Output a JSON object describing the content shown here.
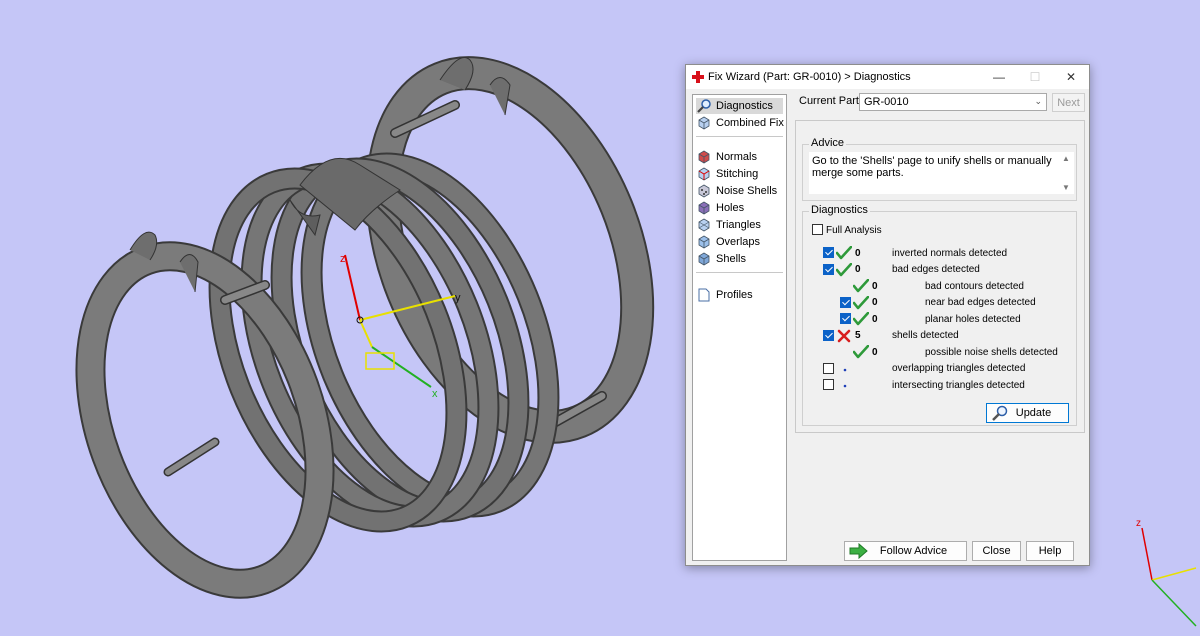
{
  "dialog": {
    "title": "Fix Wizard (Part: GR-0010) > Diagnostics",
    "window_controls": {
      "minimize": "—",
      "maximize": "☐",
      "close": "✕"
    },
    "nav": [
      {
        "label": "Diagnostics",
        "icon": "magnifier-icon",
        "active": true
      },
      {
        "label": "Combined Fix",
        "icon": "cube-icon"
      },
      {
        "label": "Normals",
        "icon": "normals-cube-icon"
      },
      {
        "label": "Stitching",
        "icon": "stitching-cube-icon"
      },
      {
        "label": "Noise Shells",
        "icon": "noise-shells-icon"
      },
      {
        "label": "Holes",
        "icon": "holes-cube-icon"
      },
      {
        "label": "Triangles",
        "icon": "triangles-cube-icon"
      },
      {
        "label": "Overlaps",
        "icon": "overlaps-cube-icon"
      },
      {
        "label": "Shells",
        "icon": "shells-cube-icon"
      },
      {
        "label": "Profiles",
        "icon": "document-icon"
      }
    ],
    "current_part": {
      "label": "Current Part:",
      "value": "GR-0010"
    },
    "next_label": "Next",
    "advice": {
      "label": "Advice",
      "text": "Go to the 'Shells' page to unify shells or manually merge some parts."
    },
    "diagnostics": {
      "label": "Diagnostics",
      "full_analysis": {
        "label": "Full Analysis",
        "checked": false
      },
      "rows": [
        {
          "checked": true,
          "status": "ok",
          "count": "0",
          "label": "inverted normals detected",
          "level": 0,
          "has_checkbox": true
        },
        {
          "checked": true,
          "status": "ok",
          "count": "0",
          "label": "bad edges detected",
          "level": 0,
          "has_checkbox": true
        },
        {
          "checked": false,
          "status": "ok",
          "count": "0",
          "label": "bad contours detected",
          "level": 1,
          "has_checkbox": false
        },
        {
          "checked": true,
          "status": "ok",
          "count": "0",
          "label": "near bad edges detected",
          "level": 1,
          "has_checkbox": true
        },
        {
          "checked": true,
          "status": "ok",
          "count": "0",
          "label": "planar holes detected",
          "level": 1,
          "has_checkbox": true
        },
        {
          "checked": true,
          "status": "error",
          "count": "5",
          "label": "shells detected",
          "level": 0,
          "has_checkbox": true
        },
        {
          "checked": false,
          "status": "ok",
          "count": "0",
          "label": "possible noise shells detected",
          "level": 1,
          "has_checkbox": false
        },
        {
          "checked": false,
          "status": "pending",
          "count": "",
          "label": "overlapping triangles detected",
          "level": 0,
          "has_checkbox": true
        },
        {
          "checked": false,
          "status": "pending",
          "count": "",
          "label": "intersecting triangles detected",
          "level": 0,
          "has_checkbox": true
        }
      ]
    },
    "buttons": {
      "update": "Update",
      "follow_advice": "Follow Advice",
      "close": "Close",
      "help": "Help"
    }
  },
  "viewport": {
    "axis_labels": {
      "x": "x",
      "y": "y",
      "z": "z"
    },
    "colors": {
      "background": "#c5c6f7",
      "model": "#6f6f6f",
      "x_axis": "#22b022",
      "y_axis": "#e8e000",
      "z_axis": "#e00000"
    }
  }
}
